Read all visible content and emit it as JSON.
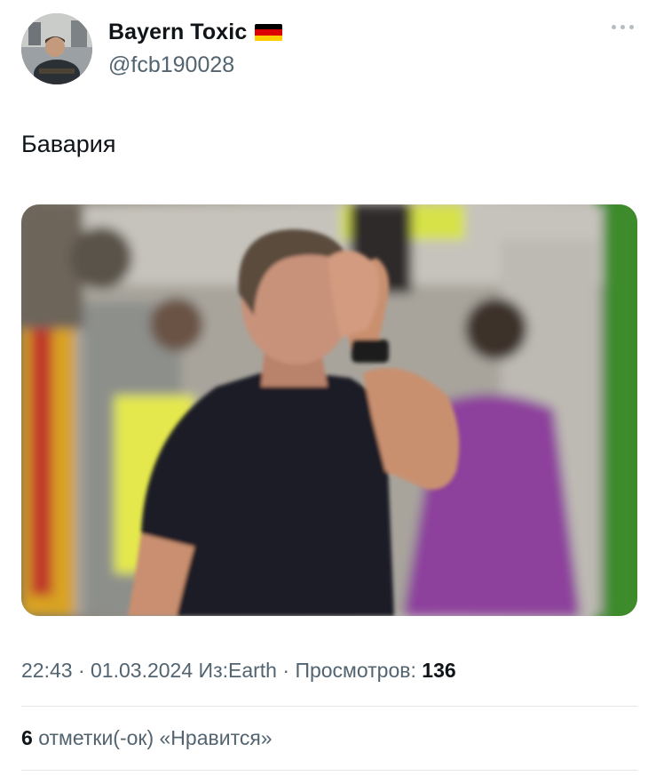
{
  "author": {
    "display_name": "Bayern Toxic",
    "flag_icon": "germany-flag-icon",
    "handle": "@fcb190028"
  },
  "tweet": {
    "text": "Бавария",
    "media_description_icon": "photo",
    "time": "22:43",
    "date": "01.03.2024",
    "source": "Из:Earth",
    "views_label": "Просмотров:",
    "views_count": "136",
    "likes_count": "6",
    "likes_label": "отметки(-ок) «Нравится»"
  },
  "colors": {
    "text_primary": "#0f1419",
    "text_secondary": "#536471",
    "flag_black": "#000000",
    "flag_red": "#dd0000",
    "flag_gold": "#ffce00"
  }
}
